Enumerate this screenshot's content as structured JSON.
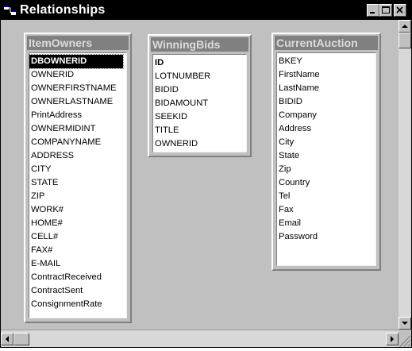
{
  "window": {
    "title": "Relationships",
    "accent": "#000000",
    "canvas_color": "#c0c0c0"
  },
  "tables": [
    {
      "name": "ItemOwners",
      "fields": [
        "DBOWNERID",
        "OWNERID",
        "OWNERFIRSTNAME",
        "OWNERLASTNAME",
        "PrintAddress",
        "OWNERMIDINT",
        "COMPANYNAME",
        "ADDRESS",
        "CITY",
        "STATE",
        "ZIP",
        "WORK#",
        "HOME#",
        "CELL#",
        "FAX#",
        "E-MAIL",
        "ContractReceived",
        "ContractSent",
        "ConsignmentRate"
      ],
      "key_fields": [
        "DBOWNERID"
      ],
      "selected_field": "DBOWNERID"
    },
    {
      "name": "WinningBids",
      "fields": [
        "ID",
        "LOTNUMBER",
        "BIDID",
        "BIDAMOUNT",
        "SEEKID",
        "TITLE",
        "OWNERID"
      ],
      "key_fields": [
        "ID"
      ],
      "selected_field": ""
    },
    {
      "name": "CurrentAuction",
      "fields": [
        "BKEY",
        "FirstName",
        "LastName",
        "BIDID",
        "Company",
        "Address",
        "City",
        "State",
        "Zip",
        "Country",
        "Tel",
        "Fax",
        "Email",
        "Password"
      ],
      "key_fields": [],
      "selected_field": ""
    }
  ],
  "icons": {
    "app": "relationships-icon",
    "minimize": "minimize-icon",
    "maximize": "maximize-icon",
    "close": "close-icon",
    "scroll_up": "arrow-up-icon",
    "scroll_down": "arrow-down-icon",
    "scroll_left": "arrow-left-icon",
    "scroll_right": "arrow-right-icon"
  }
}
